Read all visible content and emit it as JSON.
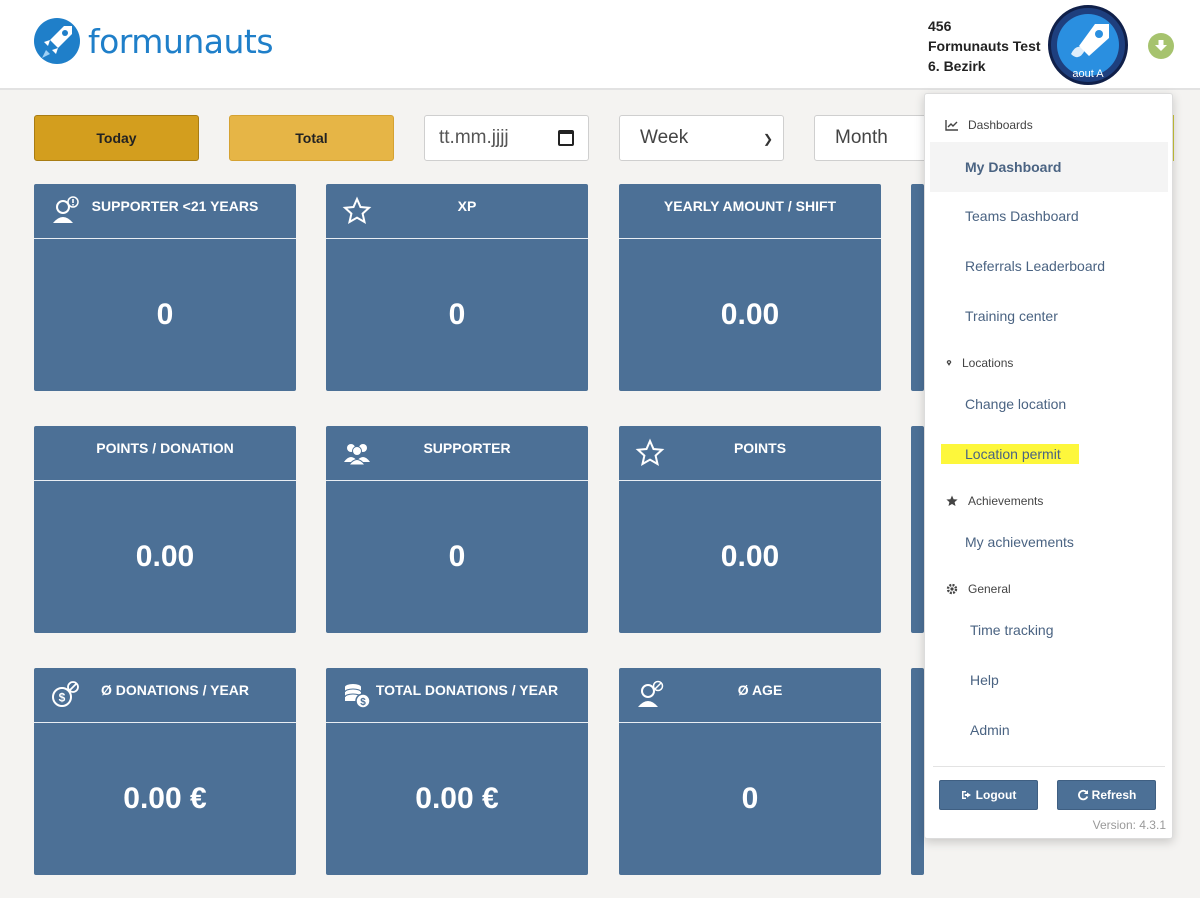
{
  "brand": {
    "name": "formunauts",
    "color": "#1f7fc9"
  },
  "user": {
    "id": "456",
    "org": "Formunauts Test",
    "district": "6. Bezirk",
    "avatar_caption": "aout A"
  },
  "filters": {
    "today_label": "Today",
    "total_label": "Total",
    "date_placeholder": "tt.mm.jjjj",
    "period_selected": "Week",
    "month_selected": "Month"
  },
  "cards": [
    {
      "title": "SUPPORTER <21 YEARS",
      "value": "0",
      "icon": "user-info-icon"
    },
    {
      "title": "XP",
      "value": "0",
      "icon": "star-icon"
    },
    {
      "title": "YEARLY AMOUNT / SHIFT",
      "value": "0.00",
      "icon": ""
    },
    {
      "title": "POINTS / DONATION",
      "value": "0.00",
      "icon": ""
    },
    {
      "title": "SUPPORTER",
      "value": "0",
      "icon": "users-icon"
    },
    {
      "title": "POINTS",
      "value": "0.00",
      "icon": "star-icon"
    },
    {
      "title": "Ø DONATIONS / YEAR",
      "value": "0.00 €",
      "icon": "money-no-icon"
    },
    {
      "title": "TOTAL DONATIONS / YEAR",
      "value": "0.00 €",
      "icon": "coins-icon"
    },
    {
      "title": "Ø AGE",
      "value": "0",
      "icon": "user-no-icon"
    }
  ],
  "menu": {
    "sections": {
      "dashboards": "Dashboards",
      "locations": "Locations",
      "achievements": "Achievements",
      "general": "General"
    },
    "items": {
      "my_dashboard": "My Dashboard",
      "teams_dashboard": "Teams Dashboard",
      "referrals": "Referrals Leaderboard",
      "training": "Training center",
      "change_location": "Change location",
      "location_permit": "Location permit",
      "my_achievements": "My achievements",
      "time_tracking": "Time tracking",
      "help": "Help",
      "admin": "Admin"
    },
    "logout_label": "Logout",
    "refresh_label": "Refresh",
    "version": "Version: 4.3.1"
  },
  "colors": {
    "card_bg": "#4c7096",
    "today_btn": "#d39e1e",
    "total_btn": "#e6b546",
    "highlight": "#fdf73b",
    "toggle": "#a6c36e"
  }
}
